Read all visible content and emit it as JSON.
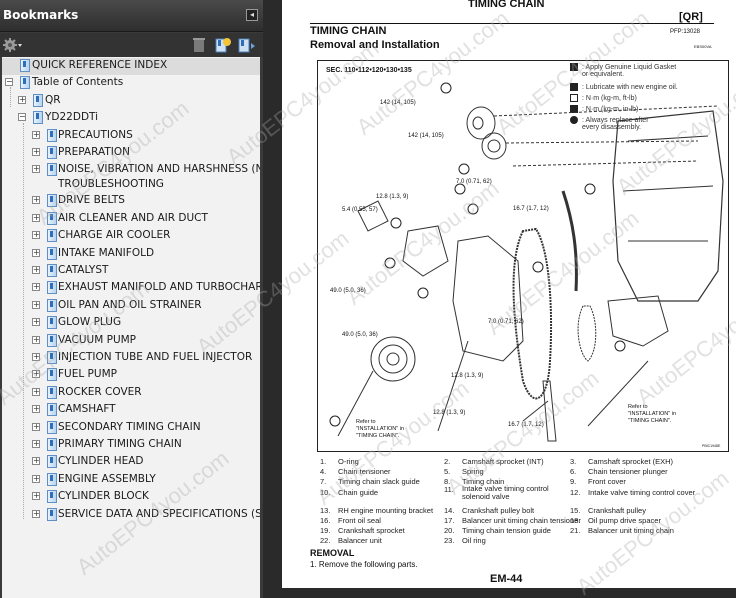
{
  "sidebar": {
    "title": "Bookmarks",
    "collapse_icon": "collapse-panel-icon",
    "toolbar": {
      "options_icon": "gear-icon",
      "delete_icon": "trash-icon",
      "new_bookmark_icon": "new-bookmark-icon",
      "expand_icon": "expand-bookmark-icon"
    },
    "tree": [
      {
        "label": "QUICK REFERENCE INDEX",
        "level": 0,
        "toggle": "",
        "selected": true
      },
      {
        "label": "Table of Contents",
        "level": 0,
        "toggle": "−"
      },
      {
        "label": "QR",
        "level": 1,
        "toggle": "+"
      },
      {
        "label": "YD22DDTi",
        "level": 1,
        "toggle": "−"
      },
      {
        "label": "PRECAUTIONS",
        "level": 2,
        "toggle": "+"
      },
      {
        "label": "PREPARATION",
        "level": 2,
        "toggle": "+"
      },
      {
        "label": "NOISE, VIBRATION AND HARSHNESS (NVH)",
        "label2": "TROUBLESHOOTING",
        "level": 2,
        "toggle": "+"
      },
      {
        "label": "DRIVE BELTS",
        "level": 2,
        "toggle": "+"
      },
      {
        "label": "AIR CLEANER AND AIR DUCT",
        "level": 2,
        "toggle": "+"
      },
      {
        "label": "CHARGE AIR COOLER",
        "level": 2,
        "toggle": "+"
      },
      {
        "label": "INTAKE MANIFOLD",
        "level": 2,
        "toggle": "+"
      },
      {
        "label": "CATALYST",
        "level": 2,
        "toggle": "+"
      },
      {
        "label": "EXHAUST MANIFOLD AND TURBOCHARGER",
        "level": 2,
        "toggle": "+"
      },
      {
        "label": "OIL PAN AND OIL STRAINER",
        "level": 2,
        "toggle": "+"
      },
      {
        "label": "GLOW PLUG",
        "level": 2,
        "toggle": "+"
      },
      {
        "label": "VACUUM PUMP",
        "level": 2,
        "toggle": "+"
      },
      {
        "label": "INJECTION TUBE AND FUEL INJECTOR",
        "level": 2,
        "toggle": "+"
      },
      {
        "label": "FUEL PUMP",
        "level": 2,
        "toggle": "+"
      },
      {
        "label": "ROCKER COVER",
        "level": 2,
        "toggle": "+"
      },
      {
        "label": "CAMSHAFT",
        "level": 2,
        "toggle": "+"
      },
      {
        "label": "SECONDARY TIMING CHAIN",
        "level": 2,
        "toggle": "+"
      },
      {
        "label": "PRIMARY TIMING CHAIN",
        "level": 2,
        "toggle": "+"
      },
      {
        "label": "CYLINDER HEAD",
        "level": 2,
        "toggle": "+"
      },
      {
        "label": "ENGINE ASSEMBLY",
        "level": 2,
        "toggle": "+"
      },
      {
        "label": "CYLINDER BLOCK",
        "level": 2,
        "toggle": "+"
      },
      {
        "label": "SERVICE DATA AND SPECIFICATIONS (SDS)",
        "level": 2,
        "toggle": "+"
      }
    ]
  },
  "page": {
    "running_header": "TIMING CHAIN",
    "engine_code": "[QR]",
    "section_title": "TIMING CHAIN",
    "pfp": "PFP:13028",
    "subtitle": "Removal and Installation",
    "figure_code_top": "EBS00VA",
    "figure_code_bottom": "PBIC1948E",
    "diagram": {
      "sec_label": "SEC. 110•112•120•130•135",
      "legend": [
        {
          "icon": "liquid-gasket-icon",
          "text": ": Apply Genuine Liquid Gasket",
          "text2": "or equivalent."
        },
        {
          "icon": "engine-oil-icon",
          "text": ": Lubricate with new engine oil."
        },
        {
          "icon": "torque-nm-icon",
          "text": ": N·m (kg-m, ft-lb)"
        },
        {
          "icon": "torque-nm-inlb-icon",
          "text": ": N·m (kg-m, in-lb)"
        },
        {
          "icon": "replace-icon",
          "text": ": Always replace after",
          "text2": "every disassembly."
        }
      ],
      "callouts": [
        "142 (14, 105)",
        "142 (14, 105)",
        "7.0 (0.71, 62)",
        "12.8 (1.3, 9)",
        "5.4 (0.55, 57)",
        "16.7 (1.7, 12)",
        "49.0 (5.0, 36)",
        "49.0 (5.0, 36)",
        "7.0 (0.71, 62)",
        "12.8 (1.3, 9)",
        "12.8 (1.3, 9)",
        "16.7 (1.7, 12)"
      ],
      "refer_note": [
        "Refer to",
        "\"INSTALLATION\" in",
        "\"TIMING CHAIN\"."
      ]
    },
    "parts": [
      [
        "1.",
        "O-ring"
      ],
      [
        "2.",
        "Camshaft sprocket (INT)"
      ],
      [
        "3.",
        "Camshaft sprocket (EXH)"
      ],
      [
        "4.",
        "Chain tensioner"
      ],
      [
        "5.",
        "Spring"
      ],
      [
        "6.",
        "Chain tensioner plunger"
      ],
      [
        "7.",
        "Timing chain slack guide"
      ],
      [
        "8.",
        "Timing chain"
      ],
      [
        "9.",
        "Front cover"
      ],
      [
        "10.",
        "Chain guide"
      ],
      [
        "11.",
        "Intake valve timing control solenoid valve"
      ],
      [
        "12.",
        "Intake valve timing control cover"
      ],
      [
        "13.",
        "RH engine mounting bracket"
      ],
      [
        "14.",
        "Crankshaft pulley bolt"
      ],
      [
        "15.",
        "Crankshaft pulley"
      ],
      [
        "16.",
        "Front oil seal"
      ],
      [
        "17.",
        "Balancer unit timing chain tensioner"
      ],
      [
        "18.",
        "Oil pump drive spacer"
      ],
      [
        "19.",
        "Crankshaft sprocket"
      ],
      [
        "20.",
        "Timing chain tension guide"
      ],
      [
        "21.",
        "Balancer unit timing chain"
      ],
      [
        "22.",
        "Balancer unit"
      ],
      [
        "23.",
        "Oil ring"
      ]
    ],
    "removal_heading": "REMOVAL",
    "removal_step": "1.    Remove the following parts.",
    "page_number": "EM-44"
  },
  "watermark": "AutoEPC4you.com"
}
